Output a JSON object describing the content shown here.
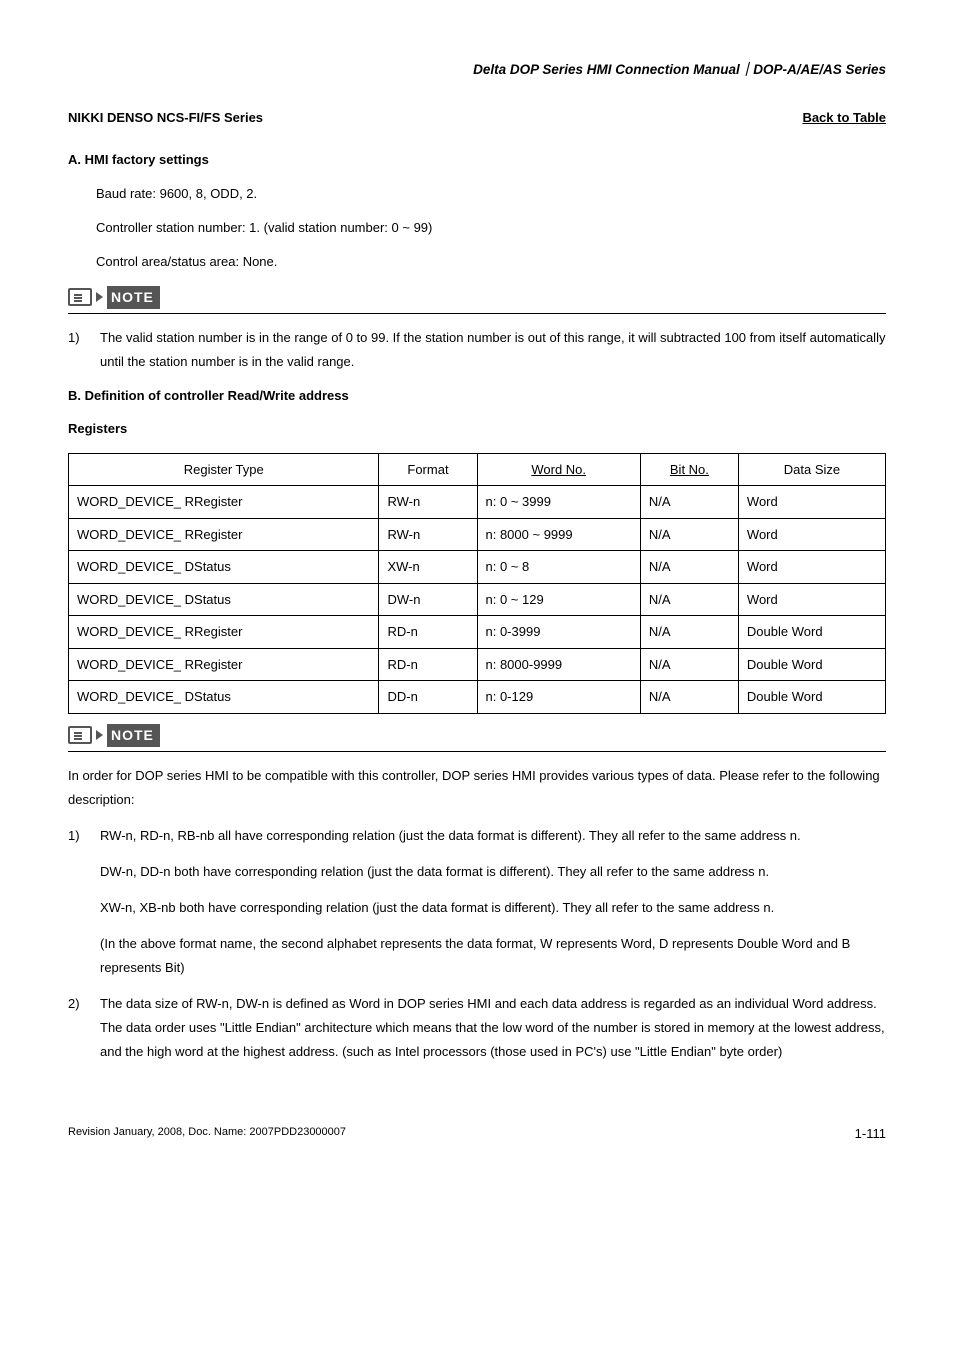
{
  "header": {
    "manual_title": "Delta DOP Series HMI Connection Manual｜DOP-A/AE/AS Series"
  },
  "title_row": {
    "device": "NIKKI DENSO NCS-FI/FS Series",
    "back": "Back to Table"
  },
  "section_a": {
    "heading": "A. HMI factory settings",
    "lines": {
      "baud": "Baud rate: 9600, 8, ODD, 2.",
      "controller": "Controller station number: 1. (valid station number: 0 ~ 99)",
      "control_area": "Control area/status area: None."
    }
  },
  "note1": {
    "badge": "NOTE",
    "item_num": "1)",
    "item_text": "The valid station number is in the range of 0 to 99. If the station number is out of this range, it will subtracted 100 from itself automatically until the station number is in the valid range."
  },
  "section_b": {
    "heading": "B. Definition of controller Read/Write address",
    "registers_label": "Registers"
  },
  "table": {
    "headers": {
      "type": "Register Type",
      "format": "Format",
      "word_no": "Word No.",
      "bit_no": "Bit No.",
      "size": "Data Size"
    },
    "rows": [
      {
        "type": "WORD_DEVICE_ RRegister",
        "format": "RW-n",
        "word_no": "n: 0 ~ 3999",
        "bit_no": "N/A",
        "size": "Word"
      },
      {
        "type": "WORD_DEVICE_ RRegister",
        "format": "RW-n",
        "word_no": "n: 8000 ~ 9999",
        "bit_no": "N/A",
        "size": "Word"
      },
      {
        "type": "WORD_DEVICE_ DStatus",
        "format": "XW-n",
        "word_no": "n: 0 ~ 8",
        "bit_no": "N/A",
        "size": "Word"
      },
      {
        "type": "WORD_DEVICE_ DStatus",
        "format": "DW-n",
        "word_no": "n: 0 ~ 129",
        "bit_no": "N/A",
        "size": "Word"
      },
      {
        "type": "WORD_DEVICE_ RRegister",
        "format": "RD-n",
        "word_no": "n: 0-3999",
        "bit_no": "N/A",
        "size": "Double Word"
      },
      {
        "type": "WORD_DEVICE_ RRegister",
        "format": "RD-n",
        "word_no": "n: 8000-9999",
        "bit_no": "N/A",
        "size": "Double Word"
      },
      {
        "type": "WORD_DEVICE_ DStatus",
        "format": "DD-n",
        "word_no": "n: 0-129",
        "bit_no": "N/A",
        "size": "Double Word"
      }
    ]
  },
  "note2": {
    "badge": "NOTE",
    "intro": "In order for DOP series HMI to be compatible with this controller, DOP series HMI provides various types of data. Please refer to the following description:",
    "items": [
      {
        "num": "1)",
        "paras": [
          "RW-n, RD-n, RB-nb all have corresponding relation (just the data format is different). They all refer to the same address n.",
          "DW-n, DD-n both have corresponding relation (just the data format is different). They all refer to the same address n.",
          "XW-n, XB-nb both have corresponding relation (just the data format is different). They all refer to the same address n.",
          "(In the above format name, the second alphabet represents the data format, W represents Word, D represents Double Word and B represents Bit)"
        ]
      },
      {
        "num": "2)",
        "paras": [
          "The data size of RW-n, DW-n is defined as Word in DOP series HMI and each data address is regarded as an individual Word address. The data order uses \"Little Endian\" architecture which means that the low word of the number is stored in memory at the lowest address, and the high word at the highest address. (such as Intel processors (those used in PC's) use \"Little Endian\" byte order)"
        ]
      }
    ]
  },
  "footer": {
    "rev": "Revision January, 2008, Doc. Name: 2007PDD23000007",
    "page": "1-111"
  }
}
